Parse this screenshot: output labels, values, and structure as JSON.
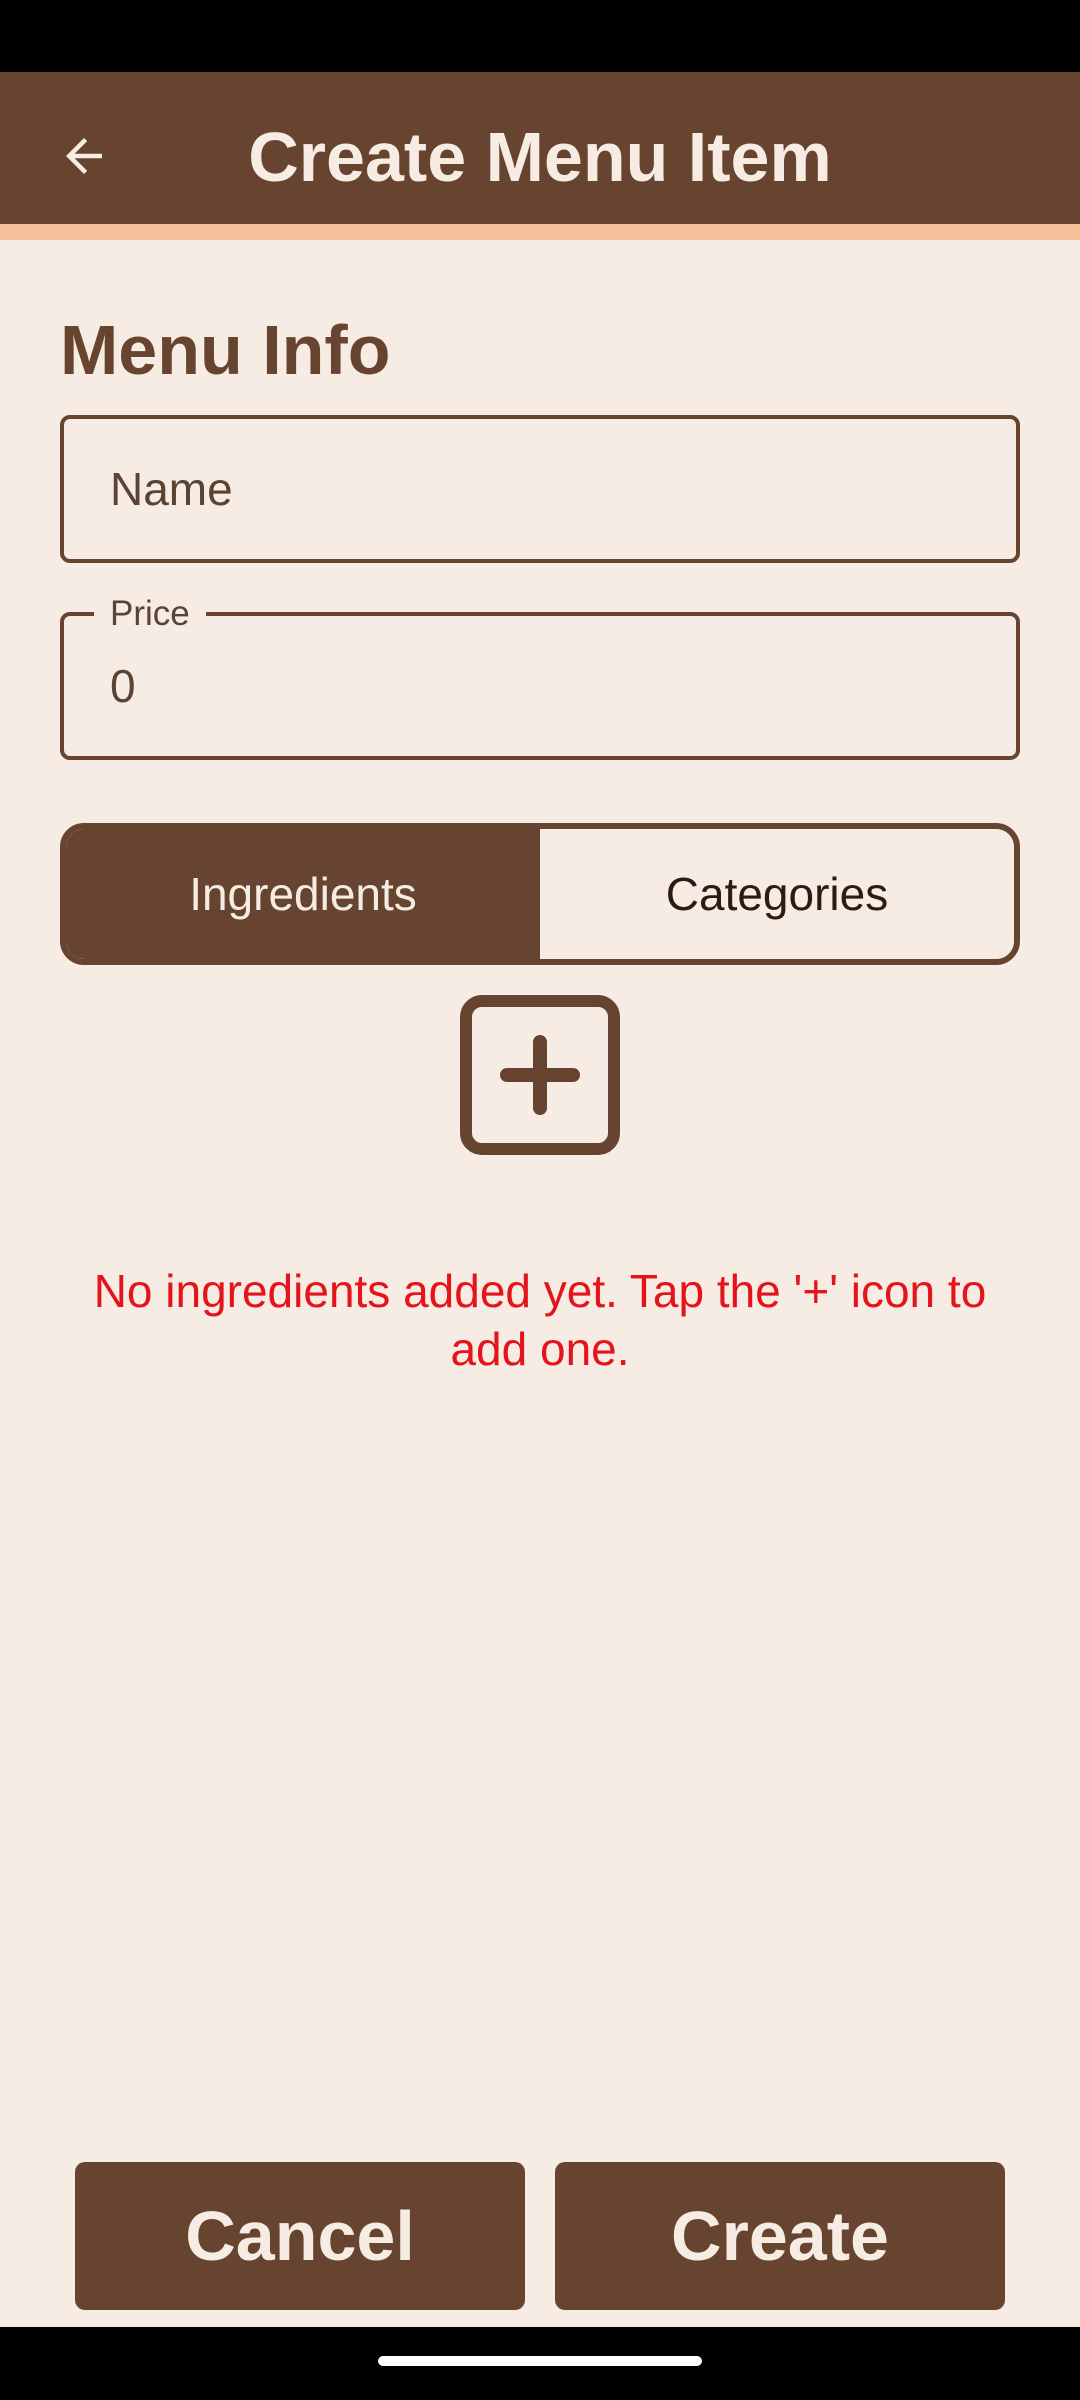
{
  "app_bar": {
    "title": "Create Menu Item",
    "back_icon": "arrow-left-icon"
  },
  "form": {
    "section_title": "Menu Info",
    "name_field": {
      "value": "",
      "placeholder": "Name"
    },
    "price_field": {
      "label": "Price",
      "value": "0"
    }
  },
  "tabs": [
    {
      "label": "Ingredients",
      "selected": true
    },
    {
      "label": "Categories",
      "selected": false
    }
  ],
  "ingredients": {
    "add_icon": "add-box-icon",
    "empty_message": "No ingredients added yet. Tap the '+' icon to add one."
  },
  "actions": {
    "cancel_label": "Cancel",
    "create_label": "Create"
  },
  "colors": {
    "primary": "#67442f",
    "background": "#f6ece3",
    "accent": "#f8c19c",
    "error": "#e5131b"
  }
}
